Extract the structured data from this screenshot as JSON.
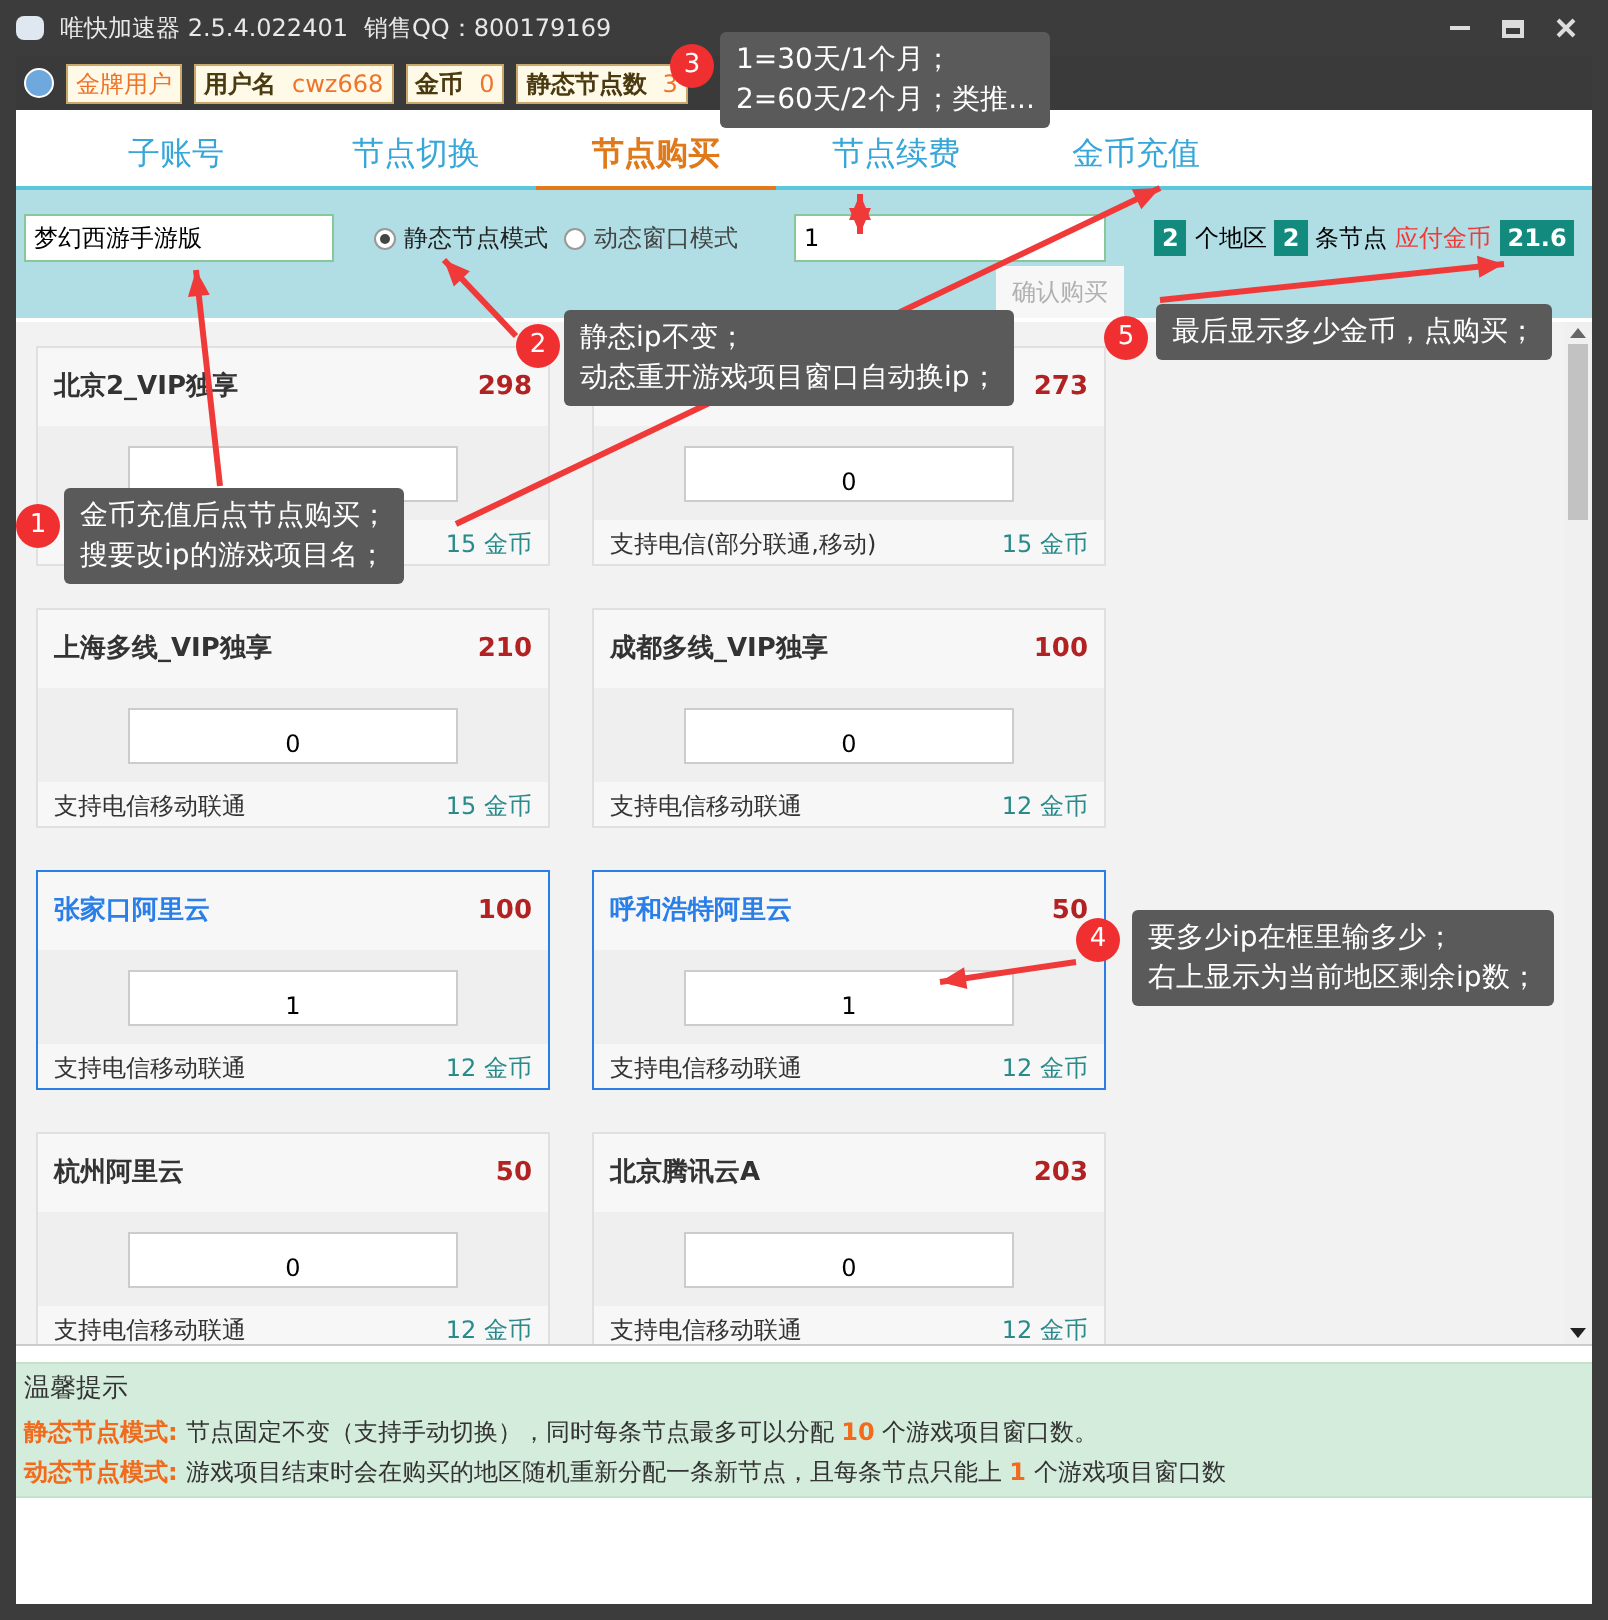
{
  "window": {
    "title": "唯快加速器 2.5.4.022401",
    "sales": "销售QQ：800179169"
  },
  "account_bar": {
    "level_badge": "金牌用户",
    "fields": [
      {
        "label": "用户名",
        "value": "cwz668"
      },
      {
        "label": "金币",
        "value": "0"
      },
      {
        "label": "静态节点数",
        "value": "3"
      }
    ]
  },
  "tabs": [
    {
      "label": "子账号",
      "selected": false
    },
    {
      "label": "节点切换",
      "selected": false
    },
    {
      "label": "节点购买",
      "selected": true
    },
    {
      "label": "节点续费",
      "selected": false
    },
    {
      "label": "金币充值",
      "selected": false
    }
  ],
  "toolbar": {
    "game_name": "梦幻西游手游版",
    "modes": [
      {
        "label": "静态节点模式",
        "selected": true
      },
      {
        "label": "动态窗口模式",
        "selected": false
      }
    ],
    "duration": "1",
    "region_count": "2",
    "region_label": "个地区",
    "node_count": "2",
    "node_label": "条节点",
    "payable_label": "应付金币",
    "payable": "21.6",
    "confirm_button": {
      "label": "确认购买",
      "disabled": true
    }
  },
  "nodes": [
    {
      "stock": "298",
      "price": "15 金币",
      "title": "北京2_VIP独享",
      "selected": false
    },
    {
      "stock": "273",
      "quantity": "0",
      "support": "支持电信(部分联通,移动)",
      "price": "15 金币",
      "selected": false
    },
    {
      "title": "上海多线_VIP独享",
      "stock": "210",
      "quantity": "0",
      "support": "支持电信移动联通",
      "price": "15 金币",
      "selected": false
    },
    {
      "title": "成都多线_VIP独享",
      "stock": "100",
      "quantity": "0",
      "support": "支持电信移动联通",
      "price": "12 金币",
      "selected": false
    },
    {
      "title": "张家口阿里云",
      "stock": "100",
      "quantity": "1",
      "support": "支持电信移动联通",
      "price": "12 金币",
      "selected": true
    },
    {
      "title": "呼和浩特阿里云",
      "stock": "50",
      "quantity": "1",
      "support": "支持电信移动联通",
      "price": "12 金币",
      "selected": true
    },
    {
      "title": "杭州阿里云",
      "stock": "50",
      "quantity": "0",
      "support": "支持电信移动联通",
      "price": "12 金币",
      "selected": false
    },
    {
      "title": "北京腾讯云A",
      "stock": "203",
      "quantity": "0",
      "support": "支持电信移动联通",
      "price": "12 金币",
      "selected": false
    }
  ],
  "tips": {
    "title": "温馨提示",
    "lines": [
      {
        "label": "静态节点模式:",
        "text": "节点固定不变（支持手动切换），同时每条节点最多可以分配 **10** 个游戏项目窗口数。"
      },
      {
        "label": "动态节点模式:",
        "text": "游戏项目结束时会在购买的地区随机重新分配一条新节点，且每条节点只能上 **1** 个游戏项目窗口数"
      }
    ]
  },
  "annotations": [
    {
      "number": "3",
      "lines": [
        "1=30天/1个月；",
        "2=60天/2个月；类推..."
      ]
    },
    {
      "number": "2",
      "lines": [
        "静态ip不变；",
        "动态重开游戏项目窗口自动换ip；"
      ]
    },
    {
      "number": "5",
      "lines": [
        "最后显示多少金币，点购买；"
      ]
    },
    {
      "number": "1",
      "lines": [
        "金币充值后点节点购买；",
        "搜要改ip的游戏项目名；"
      ]
    },
    {
      "number": "4",
      "lines": [
        "要多少ip在框里输多少；",
        "右上显示为当前地区剩余ip数；"
      ]
    }
  ]
}
